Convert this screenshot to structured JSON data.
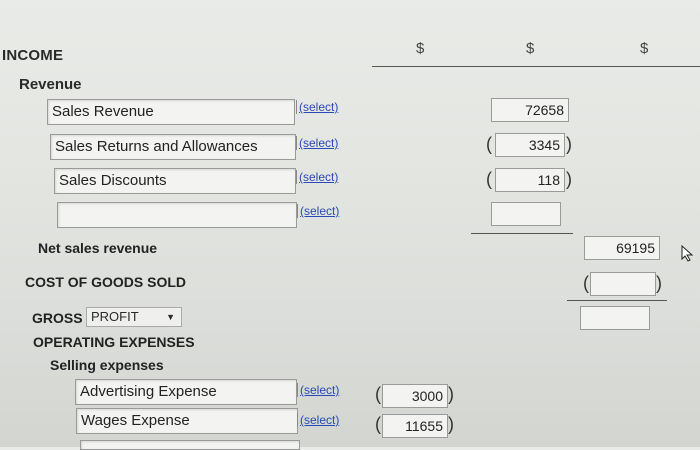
{
  "header": {
    "title": "INCOME",
    "currency": [
      "$",
      "$",
      "$"
    ]
  },
  "revenue": {
    "heading": "Revenue",
    "rows": [
      {
        "label": "Sales Revenue",
        "select": "(select)",
        "value": "72658"
      },
      {
        "label": "Sales Returns and Allowances",
        "select": "(select)",
        "value": "3345"
      },
      {
        "label": "Sales Discounts",
        "select": "(select)",
        "value": "118"
      },
      {
        "label": "",
        "select": "(select)",
        "value": ""
      }
    ]
  },
  "net_sales": {
    "label": "Net sales revenue",
    "value": "69195"
  },
  "cogs": {
    "label": "COST OF GOODS SOLD",
    "value": ""
  },
  "gross": {
    "label": "GROSS",
    "dropdown": "PROFIT",
    "value": ""
  },
  "operating": {
    "heading": "OPERATING EXPENSES",
    "selling_heading": "Selling expenses",
    "rows": [
      {
        "label": "Advertising Expense",
        "select": "(select)",
        "value": "3000"
      },
      {
        "label": "Wages Expense",
        "select": "(select)",
        "value": "11655"
      }
    ]
  }
}
